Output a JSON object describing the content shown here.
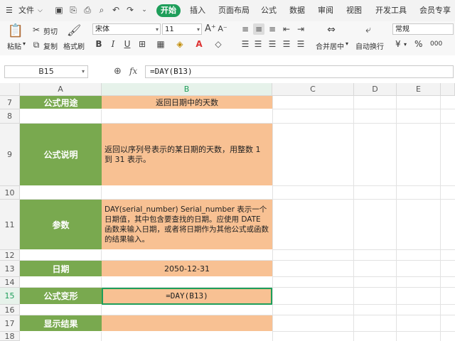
{
  "menu": {
    "file": "文件",
    "tabs": [
      "开始",
      "插入",
      "页面布局",
      "公式",
      "数据",
      "审阅",
      "视图",
      "开发工具",
      "会员专享"
    ]
  },
  "ribbon": {
    "paste": "粘贴",
    "cut": "剪切",
    "copy": "复制",
    "format_painter": "格式刷",
    "font_name": "宋体",
    "font_size": "11",
    "merge_center": "合并居中",
    "wrap_text": "自动换行",
    "number_format": "常规",
    "currency": "¥",
    "percent": "%",
    "thousands": "000"
  },
  "formula_bar": {
    "name_box": "B15",
    "fx": "fx",
    "formula": "=DAY(B13)"
  },
  "columns": [
    "A",
    "B",
    "C",
    "D",
    "E"
  ],
  "rows": [
    {
      "num": "7",
      "a": "公式用途",
      "b": "返回日期中的天数"
    },
    {
      "num": "8",
      "a": "",
      "b": ""
    },
    {
      "num": "9",
      "a": "公式说明",
      "b": "返回以序列号表示的某日期的天数，用整数 1 到 31 表示。"
    },
    {
      "num": "10",
      "a": "",
      "b": ""
    },
    {
      "num": "11",
      "a": "参数",
      "b": "DAY(serial_number) Serial_number 表示一个日期值，其中包含要查找的日期。应使用 DATE 函数来输入日期，或者将日期作为其他公式或函数的结果输入。"
    },
    {
      "num": "12",
      "a": "",
      "b": ""
    },
    {
      "num": "13",
      "a": "日期",
      "b": "2050-12-31"
    },
    {
      "num": "14",
      "a": "",
      "b": ""
    },
    {
      "num": "15",
      "a": "公式变形",
      "b": "=DAY(B13)"
    },
    {
      "num": "16",
      "a": "",
      "b": ""
    },
    {
      "num": "17",
      "a": "显示结果",
      "b": ""
    },
    {
      "num": "18",
      "a": "",
      "b": ""
    }
  ],
  "colors": {
    "accent": "#1e9e5a",
    "label_fill": "#79a94f",
    "value_fill": "#f8c193"
  }
}
